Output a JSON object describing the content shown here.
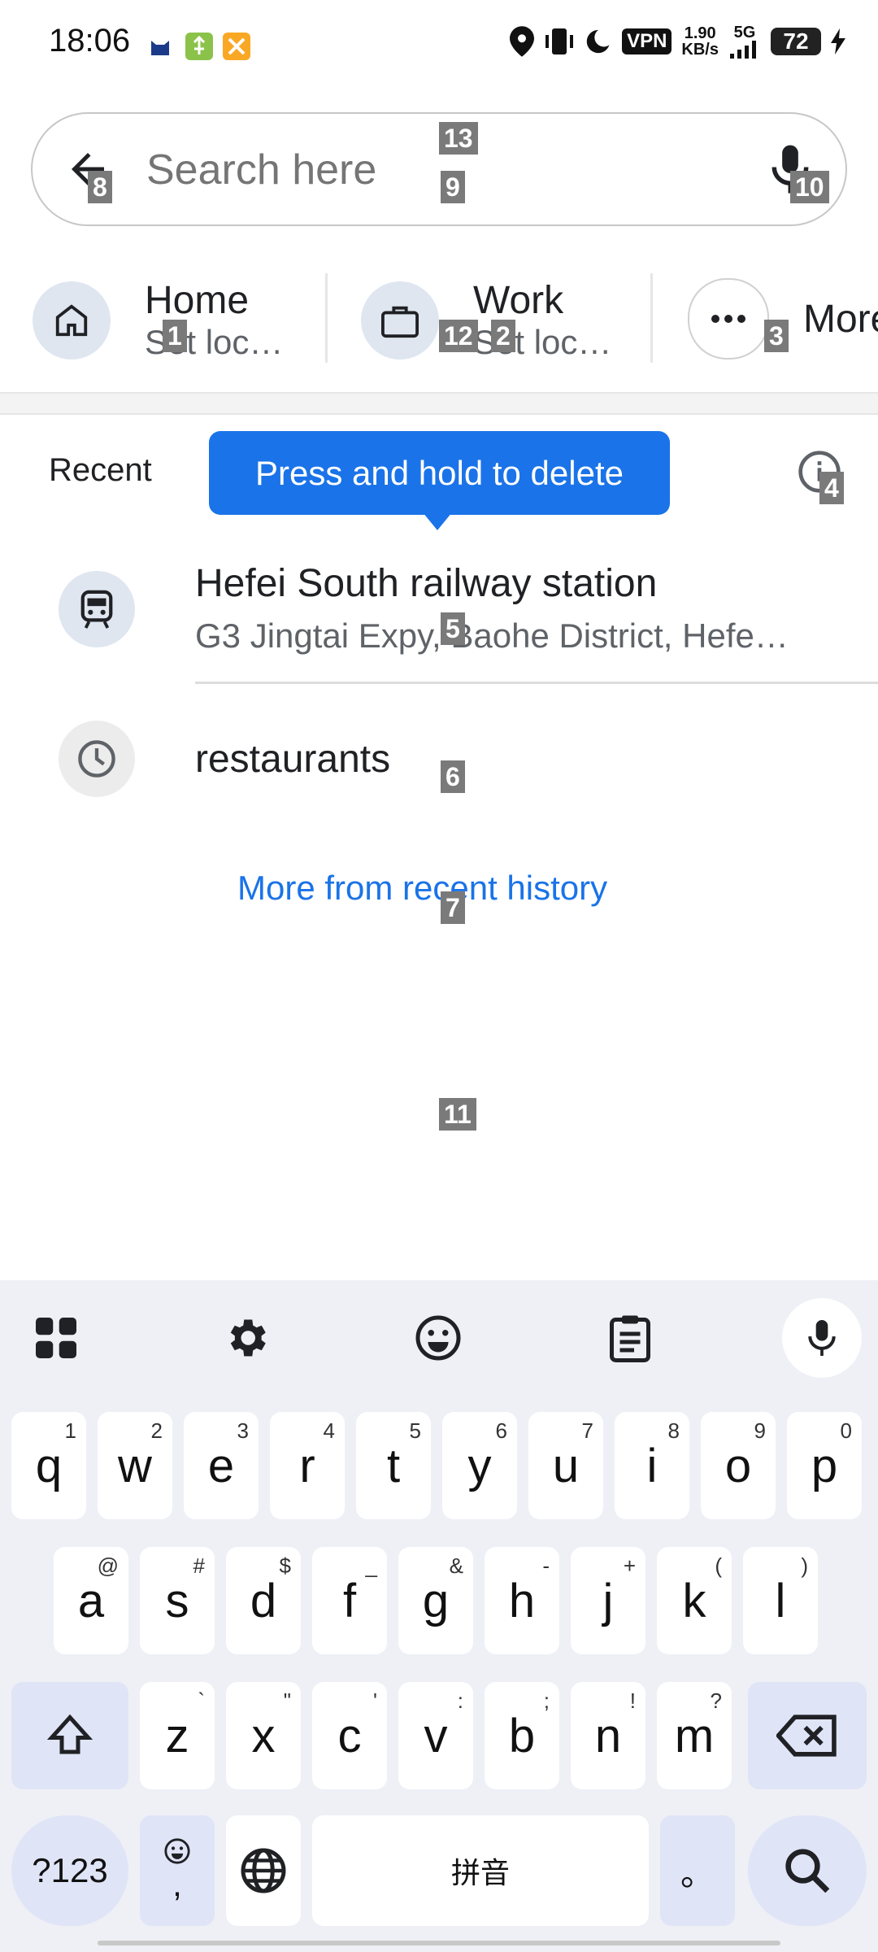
{
  "status_bar": {
    "time": "18:06",
    "net_speed_top": "1.90",
    "net_speed_unit": "KB/s",
    "network": "5G",
    "vpn": "VPN",
    "battery": "72"
  },
  "search": {
    "placeholder": "Search here"
  },
  "shortcuts": [
    {
      "title": "Home",
      "subtitle": "Set loc…",
      "icon": "home-icon"
    },
    {
      "title": "Work",
      "subtitle": "Set loc…",
      "icon": "briefcase-icon"
    },
    {
      "title": "More",
      "icon": "more-icon"
    }
  ],
  "recent": {
    "label": "Recent",
    "tooltip": "Press and hold to delete"
  },
  "recent_items": [
    {
      "title": "Hefei South railway station",
      "subtitle": "G3 Jingtai Expy, Baohe District, Hefe…",
      "icon": "train-icon"
    },
    {
      "title": "restaurants",
      "icon": "history-icon"
    }
  ],
  "more_link": "More from recent history",
  "markers": [
    "1",
    "2",
    "3",
    "4",
    "5",
    "6",
    "7",
    "8",
    "9",
    "10",
    "11",
    "12",
    "13"
  ],
  "keyboard": {
    "row1": [
      [
        "q",
        "1"
      ],
      [
        "w",
        "2"
      ],
      [
        "e",
        "3"
      ],
      [
        "r",
        "4"
      ],
      [
        "t",
        "5"
      ],
      [
        "y",
        "6"
      ],
      [
        "u",
        "7"
      ],
      [
        "i",
        "8"
      ],
      [
        "o",
        "9"
      ],
      [
        "p",
        "0"
      ]
    ],
    "row2": [
      [
        "a",
        "@"
      ],
      [
        "s",
        "#"
      ],
      [
        "d",
        "$"
      ],
      [
        "f",
        "_"
      ],
      [
        "g",
        "&"
      ],
      [
        "h",
        "-"
      ],
      [
        "j",
        "+"
      ],
      [
        "k",
        "("
      ],
      [
        "l",
        ")"
      ]
    ],
    "row3": [
      [
        "z",
        "`"
      ],
      [
        "x",
        "\""
      ],
      [
        "c",
        "'"
      ],
      [
        "v",
        ":"
      ],
      [
        "b",
        ";"
      ],
      [
        "n",
        "!"
      ],
      [
        "m",
        "?"
      ]
    ],
    "symbols": "?123",
    "comma": ",",
    "space": "拼音",
    "period": "。"
  },
  "colors": {
    "accent": "#1a73e8",
    "tooltip": "#1a73e8",
    "chip_bg": "#dfe6f0",
    "kb_bg": "#eef0f6",
    "kb_mod": "#e0e4f7"
  }
}
